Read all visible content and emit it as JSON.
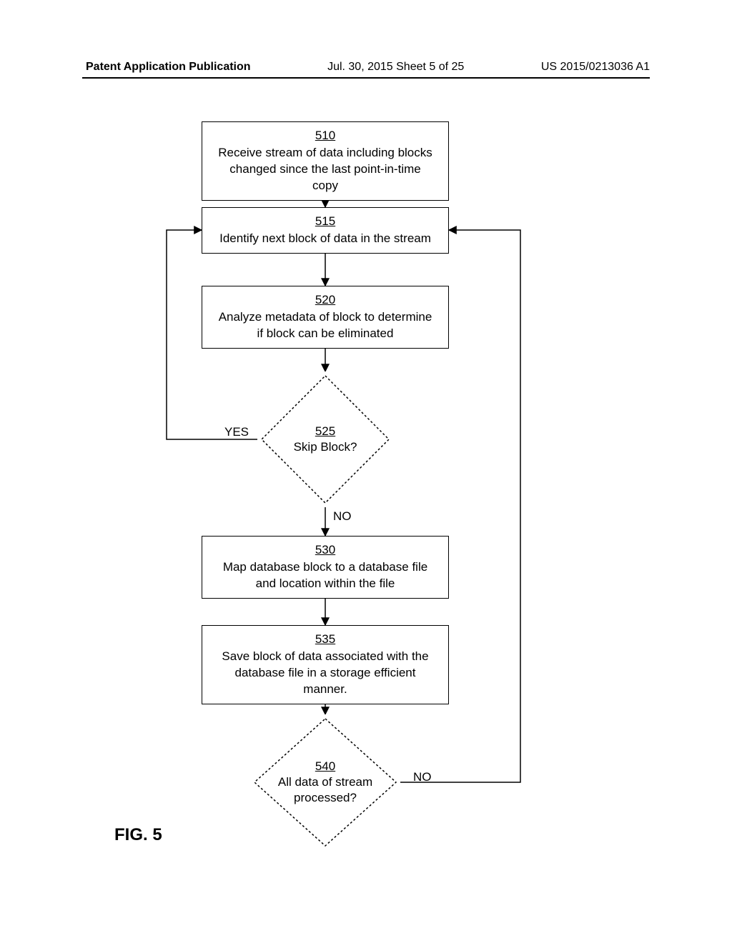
{
  "header": {
    "left": "Patent Application Publication",
    "center": "Jul. 30, 2015  Sheet 5 of 25",
    "right": "US 2015/0213036 A1"
  },
  "steps": {
    "s510": {
      "num": "510",
      "text": "Receive stream of data including blocks changed since the last point-in-time copy"
    },
    "s515": {
      "num": "515",
      "text": "Identify next block of data in the stream"
    },
    "s520": {
      "num": "520",
      "text": "Analyze metadata of block to determine if block can be eliminated"
    },
    "s525": {
      "num": "525",
      "text": "Skip Block?"
    },
    "s530": {
      "num": "530",
      "text": "Map database block to a database file and location within the file"
    },
    "s535": {
      "num": "535",
      "text": "Save block of data associated with the database file in a storage efficient manner."
    },
    "s540": {
      "num": "540",
      "text1": "All data of stream",
      "text2": "processed?"
    }
  },
  "labels": {
    "yes": "YES",
    "no1": "NO",
    "no2": "NO"
  },
  "figure": "FIG. 5",
  "chart_data": {
    "type": "flowchart",
    "nodes": [
      {
        "id": "510",
        "shape": "rect",
        "text": "Receive stream of data including blocks changed since the last point-in-time copy"
      },
      {
        "id": "515",
        "shape": "rect",
        "text": "Identify next block of data in the stream"
      },
      {
        "id": "520",
        "shape": "rect",
        "text": "Analyze metadata of block to determine if block can be eliminated"
      },
      {
        "id": "525",
        "shape": "diamond",
        "text": "Skip Block?"
      },
      {
        "id": "530",
        "shape": "rect",
        "text": "Map database block to a database file and location within the file"
      },
      {
        "id": "535",
        "shape": "rect",
        "text": "Save block of data associated with the database file in a storage efficient manner."
      },
      {
        "id": "540",
        "shape": "diamond",
        "text": "All data of stream processed?"
      }
    ],
    "edges": [
      {
        "from": "510",
        "to": "515"
      },
      {
        "from": "515",
        "to": "520"
      },
      {
        "from": "520",
        "to": "525"
      },
      {
        "from": "525",
        "to": "515",
        "label": "YES"
      },
      {
        "from": "525",
        "to": "530",
        "label": "NO"
      },
      {
        "from": "530",
        "to": "535"
      },
      {
        "from": "535",
        "to": "540"
      },
      {
        "from": "540",
        "to": "515",
        "label": "NO"
      }
    ]
  }
}
